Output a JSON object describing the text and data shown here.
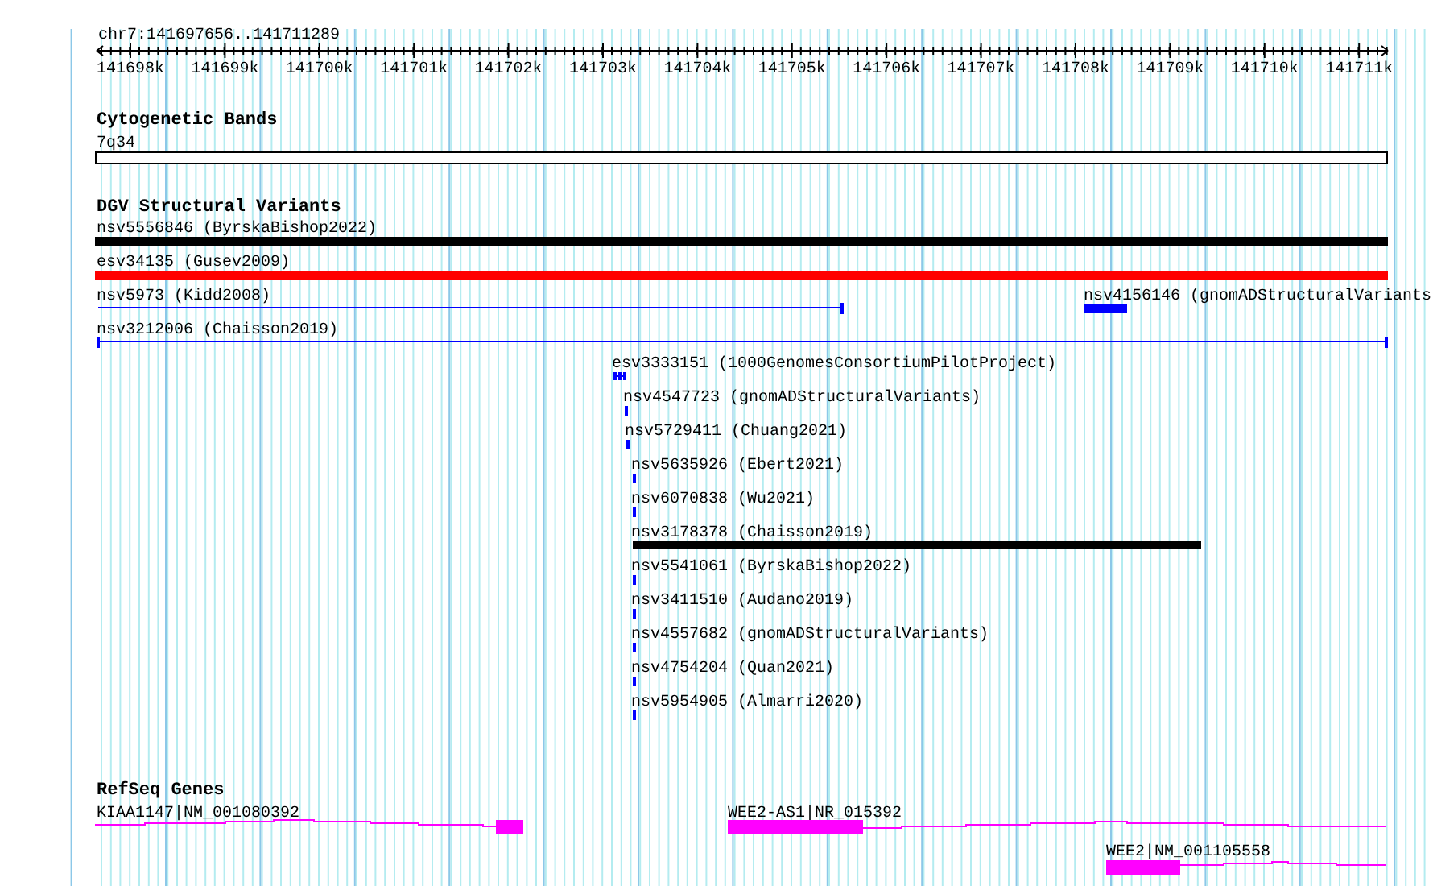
{
  "location": "chr7:141697656..141711289",
  "ruler": {
    "ticks": [
      "141698k",
      "141699k",
      "141700k",
      "141701k",
      "141702k",
      "141703k",
      "141704k",
      "141705k",
      "141706k",
      "141707k",
      "141708k",
      "141709k",
      "141710k",
      "141711k"
    ]
  },
  "tracks": [
    {
      "kind": "cytoband",
      "title": "Cytogenetic Bands",
      "features": [
        {
          "label": "7q34",
          "color": "#000000"
        }
      ]
    },
    {
      "kind": "variants",
      "title": "DGV Structural Variants",
      "features": [
        {
          "label": "nsv5556846 (ByrskaBishop2022)",
          "color": "#000000"
        },
        {
          "label": "esv34135 (Gusev2009)",
          "color": "#ff0000"
        },
        {
          "label": "nsv5973 (Kidd2008)",
          "color": "#0000ff"
        },
        {
          "label": "nsv4156146 (gnomADStructuralVariants",
          "color": "#0000ff"
        },
        {
          "label": "nsv3212006 (Chaisson2019)",
          "color": "#0000ff"
        },
        {
          "label": "esv3333151 (1000GenomesConsortiumPilotProject)",
          "color": "#0000ff"
        },
        {
          "label": "nsv4547723 (gnomADStructuralVariants)",
          "color": "#0000ff"
        },
        {
          "label": "nsv5729411 (Chuang2021)",
          "color": "#0000ff"
        },
        {
          "label": "nsv5635926 (Ebert2021)",
          "color": "#0000ff"
        },
        {
          "label": "nsv6070838 (Wu2021)",
          "color": "#0000ff"
        },
        {
          "label": "nsv3178378 (Chaisson2019)",
          "color": "#000000"
        },
        {
          "label": "nsv5541061 (ByrskaBishop2022)",
          "color": "#0000ff"
        },
        {
          "label": "nsv3411510 (Audano2019)",
          "color": "#0000ff"
        },
        {
          "label": "nsv4557682 (gnomADStructuralVariants)",
          "color": "#0000ff"
        },
        {
          "label": "nsv4754204 (Quan2021)",
          "color": "#0000ff"
        },
        {
          "label": "nsv5954905 (Almarri2020)",
          "color": "#0000ff"
        }
      ]
    },
    {
      "kind": "genes",
      "title": "RefSeq Genes",
      "features": [
        {
          "label": "KIAA1147|NM_001080392",
          "color": "#ff00ff"
        },
        {
          "label": "WEE2-AS1|NR_015392",
          "color": "#ff00ff"
        },
        {
          "label": "WEE2|NM_001105558",
          "color": "#ff00ff"
        }
      ]
    }
  ]
}
